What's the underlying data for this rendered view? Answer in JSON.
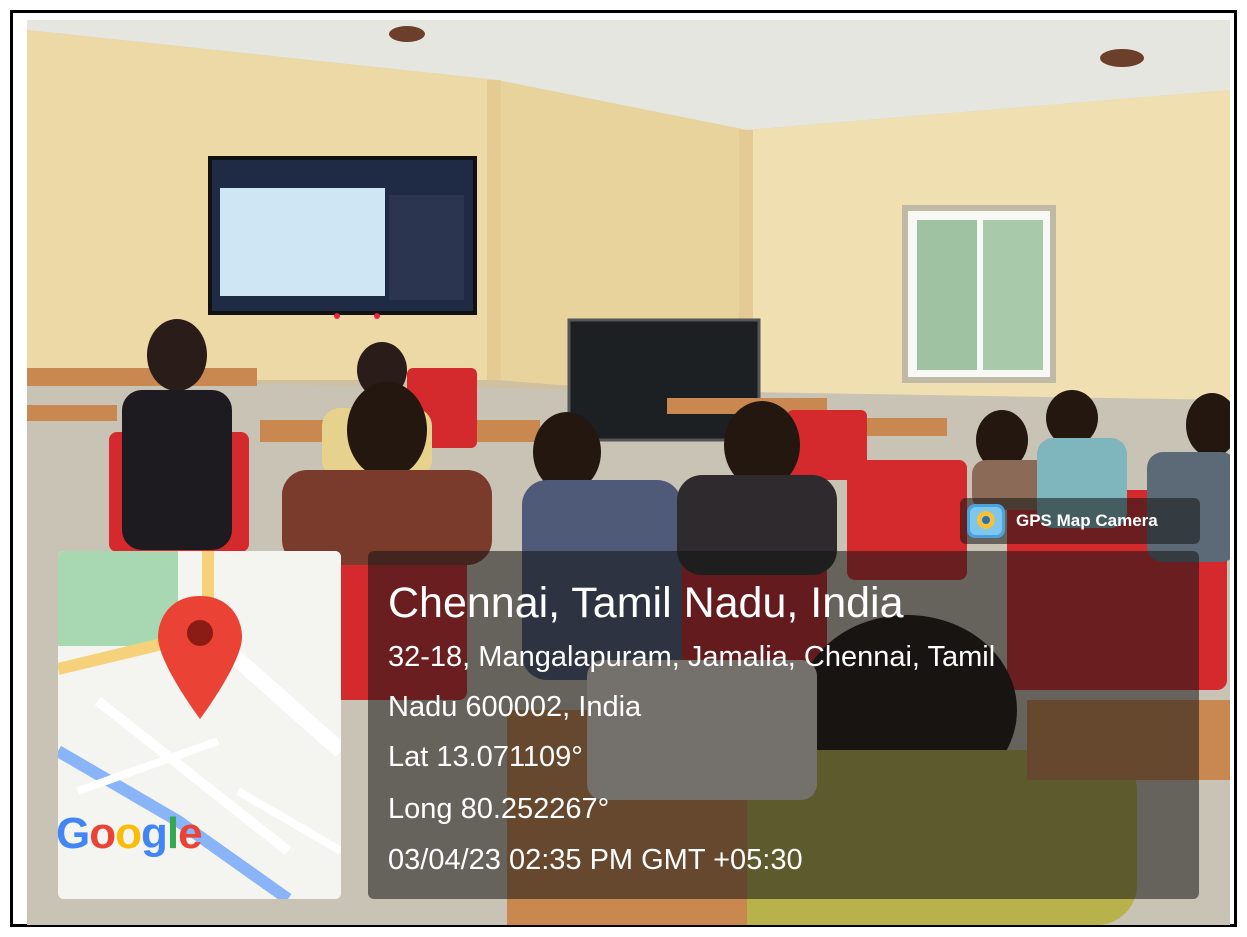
{
  "badge": {
    "label": "GPS Map Camera",
    "icon": "camera-icon"
  },
  "location": {
    "city_line": "Chennai, Tamil Nadu, India",
    "address_line1": "32-18, Mangalapuram, Jamalia, Chennai, Tamil",
    "address_line2": "Nadu 600002, India",
    "latitude": "Lat 13.071109°",
    "longitude": "Long 80.252267°",
    "timestamp": "03/04/23 02:35 PM GMT +05:30"
  },
  "map": {
    "pin_color": "#EA4335",
    "brand": {
      "g1": "G",
      "o1": "o",
      "o2": "o",
      "g2": "g",
      "l": "l",
      "e": "e"
    }
  },
  "colors": {
    "wall": "#e9d7a8",
    "chair": "#d42a2e",
    "screen_bg": "#1f2a44"
  }
}
